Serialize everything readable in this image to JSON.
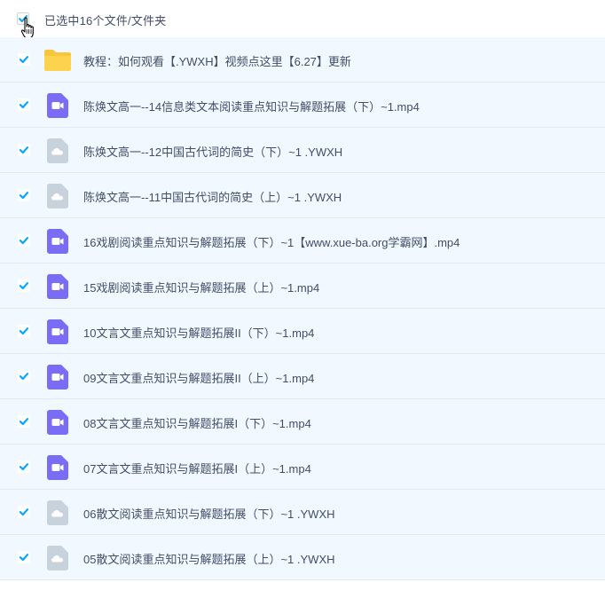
{
  "header": {
    "selection_label": "已选中16个文件/文件夹"
  },
  "files": [
    {
      "name": "教程：如何观看【.YWXH】视频点这里【6.27】更新",
      "type": "folder",
      "icon": "folder-icon"
    },
    {
      "name": "陈焕文高一--14信息类文本阅读重点知识与解题拓展（下）~1.mp4",
      "type": "video",
      "icon": "video-icon"
    },
    {
      "name": "陈焕文高一--12中国古代词的简史（下）~1 .YWXH",
      "type": "cloud",
      "icon": "cloud-file-icon"
    },
    {
      "name": "陈焕文高一--11中国古代词的简史（上）~1 .YWXH",
      "type": "cloud",
      "icon": "cloud-file-icon"
    },
    {
      "name": "16戏剧阅读重点知识与解题拓展（下）~1【www.xue-ba.org学霸网】.mp4",
      "type": "video",
      "icon": "video-icon"
    },
    {
      "name": "15戏剧阅读重点知识与解题拓展（上）~1.mp4",
      "type": "video",
      "icon": "video-icon"
    },
    {
      "name": "10文言文重点知识与解题拓展II（下）~1.mp4",
      "type": "video",
      "icon": "video-icon"
    },
    {
      "name": "09文言文重点知识与解题拓展II（上）~1.mp4",
      "type": "video",
      "icon": "video-icon"
    },
    {
      "name": "08文言文重点知识与解题拓展I（下）~1.mp4",
      "type": "video",
      "icon": "video-icon"
    },
    {
      "name": "07文言文重点知识与解题拓展I（上）~1.mp4",
      "type": "video",
      "icon": "video-icon"
    },
    {
      "name": "06散文阅读重点知识与解题拓展（下）~1 .YWXH",
      "type": "cloud",
      "icon": "cloud-file-icon"
    },
    {
      "name": "05散文阅读重点知识与解题拓展（上）~1 .YWXH",
      "type": "cloud",
      "icon": "cloud-file-icon"
    }
  ],
  "colors": {
    "checkbox_blue": "#06a7ff",
    "row_selected_bg": "#f2f8ff",
    "video_purple": "#7b6cf6",
    "cloud_grey": "#c7d2dc",
    "folder_yellow": "#fcc83d",
    "text": "#424e67"
  }
}
